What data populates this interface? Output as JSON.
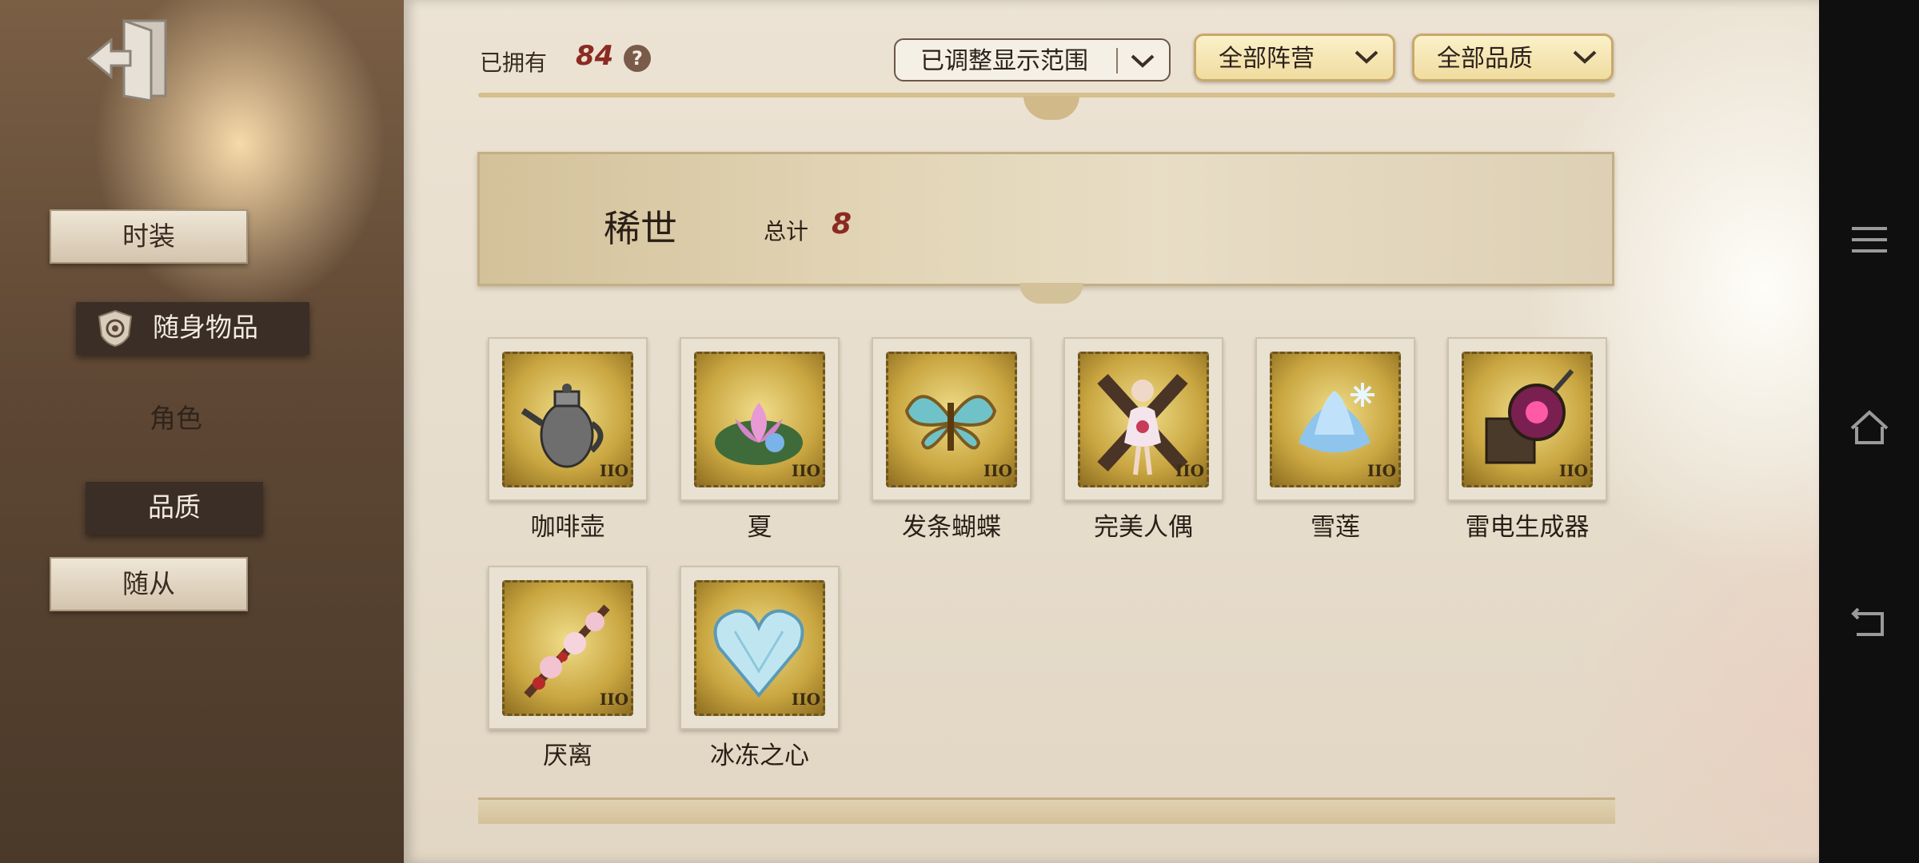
{
  "sidebar": {
    "items": [
      {
        "label": "时装"
      },
      {
        "label": "随身物品"
      },
      {
        "label": "角色"
      },
      {
        "label": "品质"
      },
      {
        "label": "随从"
      }
    ]
  },
  "header": {
    "owned_label": "已拥有",
    "owned_count": "84",
    "help_symbol": "?",
    "dropdowns": [
      {
        "label": "已调整显示范围"
      },
      {
        "label": "全部阵营"
      },
      {
        "label": "全部品质"
      }
    ]
  },
  "group": {
    "title": "稀世",
    "total_label": "总计",
    "total_value": "8"
  },
  "items": [
    {
      "name": "咖啡壶",
      "icon": "coffee-pot-icon",
      "tag": "IIO"
    },
    {
      "name": "夏",
      "icon": "lotus-icon",
      "tag": "IIO"
    },
    {
      "name": "发条蝴蝶",
      "icon": "butterfly-icon",
      "tag": "IIO"
    },
    {
      "name": "完美人偶",
      "icon": "doll-icon",
      "tag": "IIO"
    },
    {
      "name": "雪莲",
      "icon": "snow-lotus-icon",
      "tag": "IIO"
    },
    {
      "name": "雷电生成器",
      "icon": "lightning-generator-icon",
      "tag": "IIO"
    },
    {
      "name": "厌离",
      "icon": "blossom-branch-icon",
      "tag": "IIO"
    },
    {
      "name": "冰冻之心",
      "icon": "frozen-heart-icon",
      "tag": "IIO"
    }
  ],
  "colors": {
    "accent_red": "#8a2b22",
    "gold": "#c9a640",
    "paper": "#ece3d4"
  }
}
